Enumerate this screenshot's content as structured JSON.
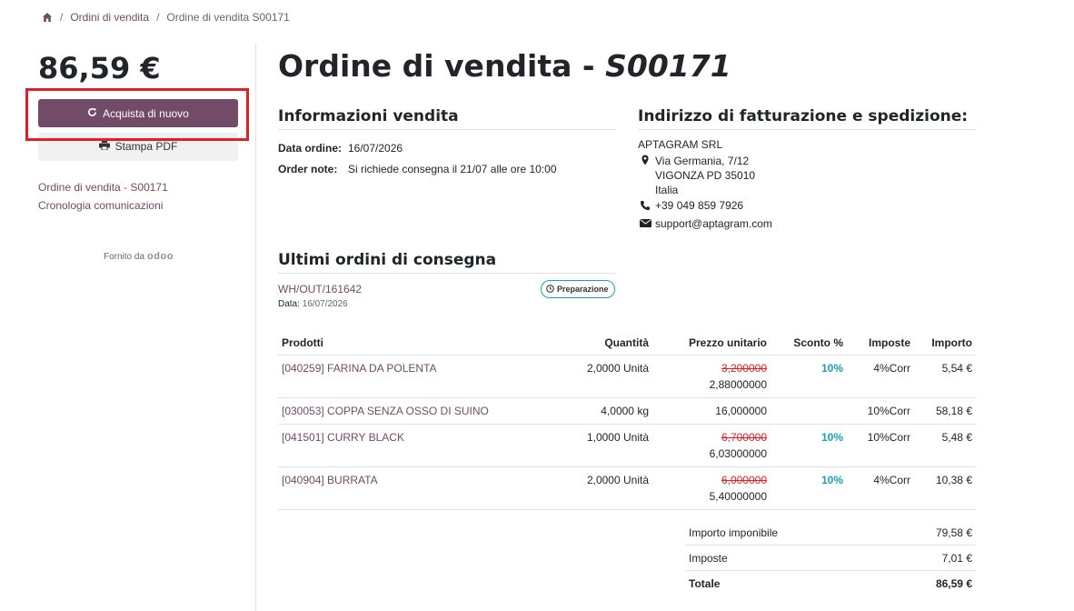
{
  "breadcrumb": {
    "home_icon": "home-icon",
    "items": [
      "Ordini di vendita",
      "Ordine di vendita S00171"
    ]
  },
  "sidebar": {
    "amount": "86,59 €",
    "reorder_label": "Acquista di nuovo",
    "print_label": "Stampa PDF",
    "links": [
      "Ordine di vendita - S00171",
      "Cronologia comunicazioni"
    ],
    "powered_by": "Fornito da",
    "brand": "odoo"
  },
  "header": {
    "title_prefix": "Ordine di vendita - ",
    "order_ref": "S00171"
  },
  "sales_info": {
    "title": "Informazioni vendita",
    "date_label": "Data ordine:",
    "date_value": "16/07/2026",
    "note_label": "Order note:",
    "note_value": "Si richiede consegna il 21/07 alle ore 10:00"
  },
  "address": {
    "title": "Indirizzo di fatturazione e spedizione:",
    "company": "APTAGRAM SRL",
    "street": "Via Germania, 7/12",
    "city": "VIGONZA PD 35010",
    "country": "Italia",
    "phone": "+39 049 859 7926",
    "email": "support@aptagram.com"
  },
  "deliveries": {
    "title": "Ultimi ordini di consegna",
    "ref": "WH/OUT/161642",
    "date_label": "Data:",
    "date_value": "16/07/2026",
    "status": "Preparazione"
  },
  "lines": {
    "headers": {
      "product": "Prodotti",
      "qty": "Quantità",
      "unit_price": "Prezzo unitario",
      "discount": "Sconto %",
      "taxes": "Imposte",
      "amount": "Importo"
    },
    "rows": [
      {
        "product": "[040259] FARINA DA POLENTA",
        "qty": "2,0000 Unità",
        "orig_price": "3,200000",
        "price": "2,88000000",
        "discount": "10%",
        "taxes": "4%Corr",
        "amount": "5,54 €"
      },
      {
        "product": "[030053] COPPA SENZA OSSO DI SUINO",
        "qty": "4,0000 kg",
        "orig_price": "",
        "price": "16,000000",
        "discount": "",
        "taxes": "10%Corr",
        "amount": "58,18 €"
      },
      {
        "product": "[041501] CURRY BLACK",
        "qty": "1,0000 Unità",
        "orig_price": "6,700000",
        "price": "6,03000000",
        "discount": "10%",
        "taxes": "10%Corr",
        "amount": "5,48 €"
      },
      {
        "product": "[040904] BURRATA",
        "qty": "2,0000 Unità",
        "orig_price": "6,000000",
        "price": "5,40000000",
        "discount": "10%",
        "taxes": "4%Corr",
        "amount": "10,38 €"
      }
    ]
  },
  "totals": {
    "untaxed_label": "Importo imponibile",
    "untaxed_value": "79,58 €",
    "taxes_label": "Imposte",
    "taxes_value": "7,01 €",
    "total_label": "Totale",
    "total_value": "86,59 €"
  },
  "colors": {
    "brand": "#714b67",
    "discount": "#17a2b8",
    "strike": "#e41e26",
    "highlight": "#e41e26"
  }
}
